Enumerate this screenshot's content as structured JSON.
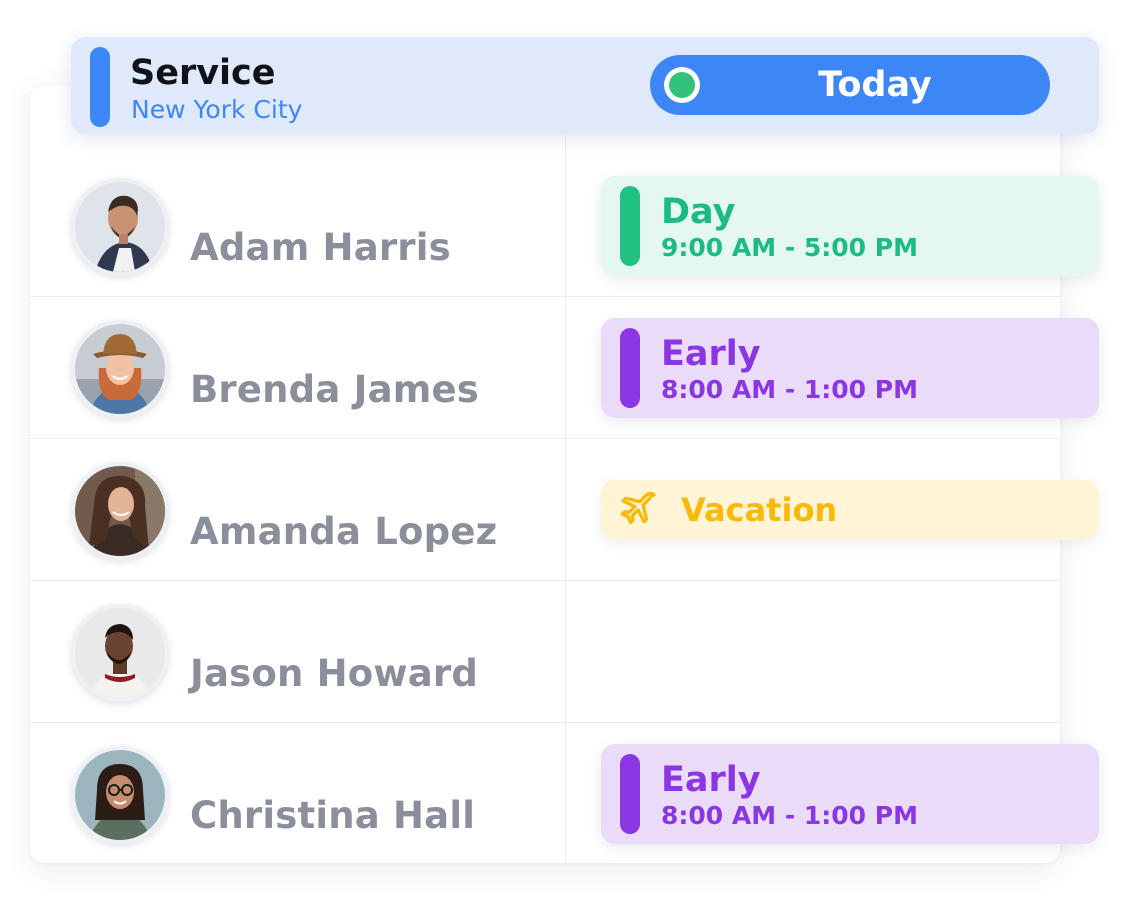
{
  "header": {
    "title": "Service",
    "subtitle": "New York City",
    "today_label": "Today",
    "accent_color": "#3d86f5",
    "status_color": "#31c27b"
  },
  "employees": [
    {
      "name": "Adam Harris",
      "shift": {
        "type": "day",
        "label": "Day",
        "time": "9:00 AM - 5:00 PM",
        "color": "#1cbc80"
      }
    },
    {
      "name": "Brenda James",
      "shift": {
        "type": "early",
        "label": "Early",
        "time": "8:00 AM - 1:00 PM",
        "color": "#8a36e4"
      }
    },
    {
      "name": "Amanda Lopez",
      "shift": {
        "type": "vacation",
        "label": "Vacation",
        "icon": "airplane-icon",
        "color": "#f9b90b"
      }
    },
    {
      "name": "Jason Howard",
      "shift": null
    },
    {
      "name": "Christina Hall",
      "shift": {
        "type": "early",
        "label": "Early",
        "time": "8:00 AM - 1:00 PM",
        "color": "#8a36e4"
      }
    }
  ]
}
